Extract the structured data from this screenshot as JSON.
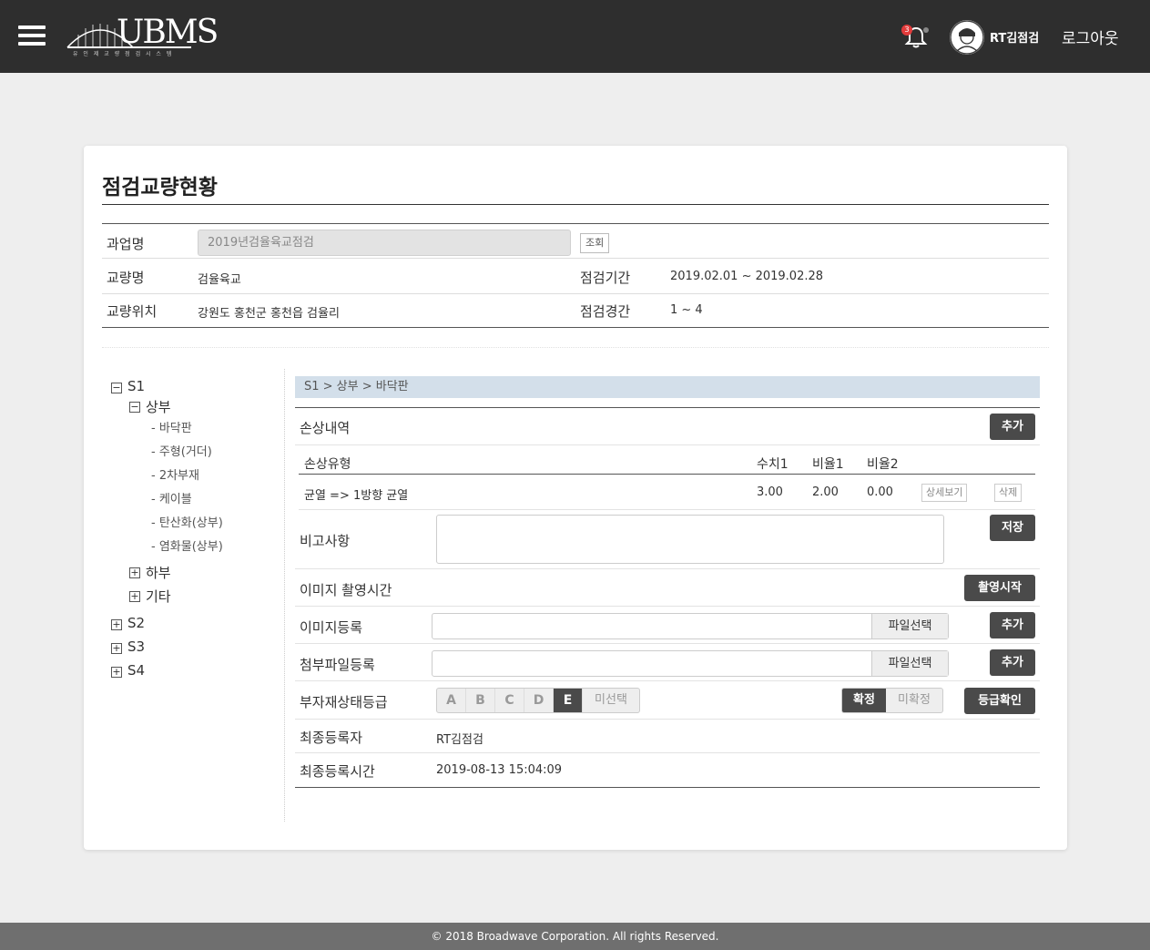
{
  "header": {
    "logo_text": "UBMS",
    "logo_sub": "유 인 제   교 량 점 검 시 스 템",
    "notification_count": "3",
    "user_name": "RT김점검",
    "logout_label": "로그아웃"
  },
  "page": {
    "title": "점검교량현황"
  },
  "info": {
    "project_label": "과업명",
    "project_value": "2019년검율육교점검",
    "query_button": "조회",
    "bridge_label": "교량명",
    "bridge_value": "검율육교",
    "period_label": "점검기간",
    "period_value": "2019.02.01 ~ 2019.02.28",
    "location_label": "교량위치",
    "location_value": "강원도 홍천군 홍천읍 검율리",
    "span_label": "점검경간",
    "span_value": "1 ~ 4"
  },
  "tree": {
    "s1": {
      "label": "S1",
      "toggle": "−"
    },
    "upper": {
      "label": "상부",
      "toggle": "−"
    },
    "leaves": [
      "- 바닥판",
      "- 주형(거더)",
      "- 2차부재",
      "- 케이블",
      "- 탄산화(상부)",
      "- 염화물(상부)"
    ],
    "lower": {
      "label": "하부",
      "toggle": "+"
    },
    "etc": {
      "label": "기타",
      "toggle": "+"
    },
    "s2": {
      "label": "S2",
      "toggle": "+"
    },
    "s3": {
      "label": "S3",
      "toggle": "+"
    },
    "s4": {
      "label": "S4",
      "toggle": "+"
    }
  },
  "panel": {
    "breadcrumb": "S1   >   상부   >   바닥판",
    "damage_label": "손상내역",
    "add_button": "추가",
    "columns": {
      "type": "손상유형",
      "value1": "수치1",
      "ratio1": "비율1",
      "ratio2": "비율2"
    },
    "damage_row": {
      "type": "균열 => 1방향 균열",
      "value1": "3.00",
      "ratio1": "2.00",
      "ratio2": "0.00",
      "detail_button": "상세보기",
      "delete_button": "삭제"
    },
    "remarks_label": "비고사항",
    "save_button": "저장",
    "photo_time_label": "이미지 촬영시간",
    "photo_start_button": "촬영시작",
    "image_label": "이미지등록",
    "file_select": "파일선택",
    "image_add_button": "추가",
    "attach_label": "첨부파일등록",
    "attach_add_button": "추가",
    "grade_label": "부자재상태등급",
    "grades": [
      "A",
      "B",
      "C",
      "D",
      "E"
    ],
    "grade_selected": "E",
    "grade_none": "미선택",
    "confirm_on": "확정",
    "confirm_off": "미확정",
    "grade_check_button": "등급확인",
    "last_user_label": "최종등록자",
    "last_user_value": "RT김점검",
    "last_time_label": "최종등록시간",
    "last_time_value": "2019-08-13 15:04:09"
  },
  "footer": {
    "copyright": "© 2018 Broadwave Corporation. All rights Reserved."
  },
  "colors": {
    "header_bg": "#2e2e2e",
    "breadcrumb_bg": "#d3dfea",
    "dark_button": "#4a4a4a",
    "badge": "#e23b3b",
    "footer_bg": "#6f6f6f"
  }
}
